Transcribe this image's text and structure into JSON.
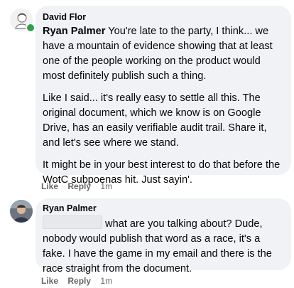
{
  "comments": [
    {
      "author": "David Flor",
      "mention": "Ryan Palmer",
      "paragraphs": [
        " You're late to the party, I think... we have a mountain of evidence showing that at least one of the people working on the product would most definitely publish such a thing.",
        "Like I said... it's really easy to settle all this. The original document, which we know is on Google Drive, has an easily verifiable audit trail. Share it, and let's see where we stand.",
        "It might be in your best interest to do that before the WotC subpoenas hit. Just sayin'."
      ],
      "actions": {
        "like": "Like",
        "reply": "Reply",
        "time": "1m"
      },
      "online": true
    },
    {
      "author": "Ryan Palmer",
      "text": " what are you talking about? Dude, nobody would publish that word as a race, it's a fake. I have the game in my email and there is the race straight from the document.",
      "actions": {
        "like": "Like",
        "reply": "Reply",
        "time": "1m"
      }
    }
  ],
  "colors": {
    "bubble": "#f0f2f5",
    "meta_text": "#65676b",
    "online": "#31a24c"
  }
}
